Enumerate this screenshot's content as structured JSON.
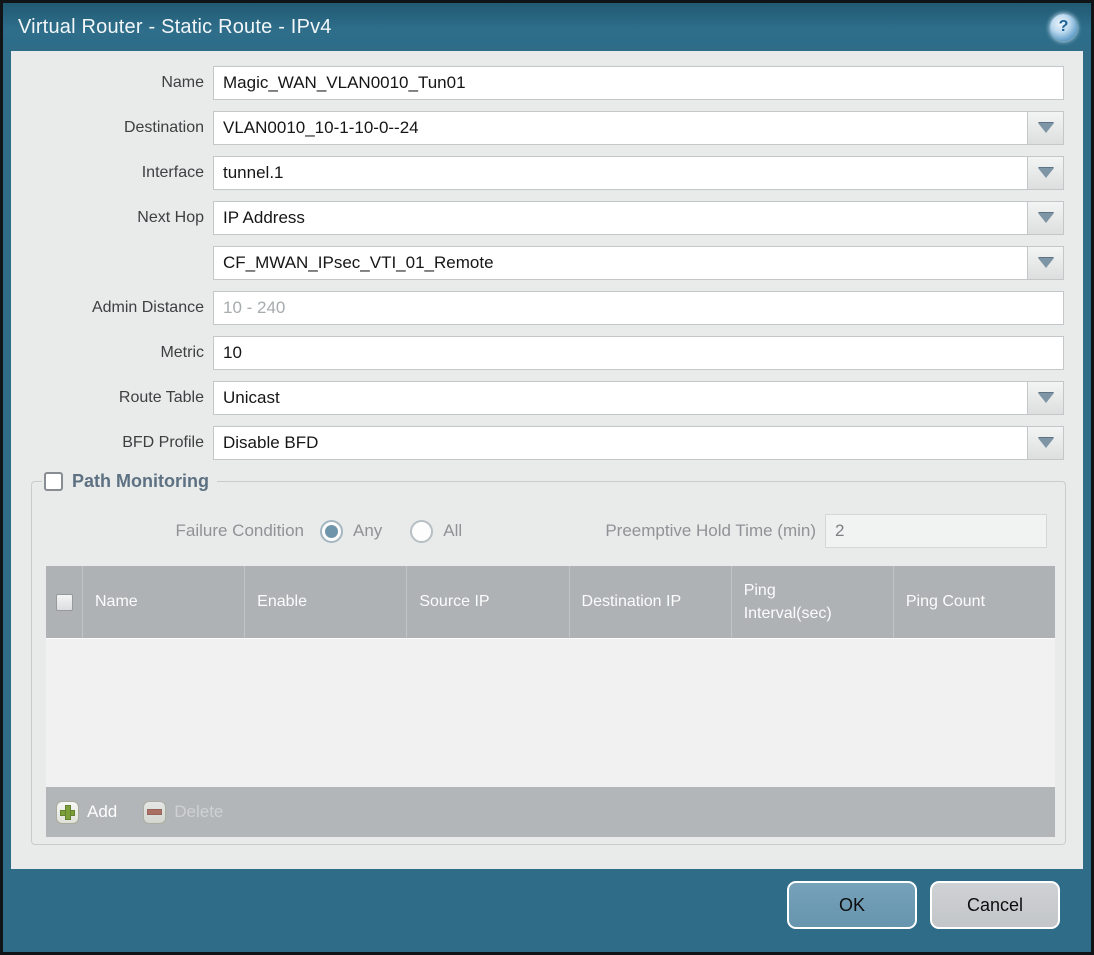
{
  "titlebar": {
    "title": "Virtual Router - Static Route - IPv4",
    "help_glyph": "?"
  },
  "form": {
    "name": {
      "label": "Name",
      "value": "Magic_WAN_VLAN0010_Tun01"
    },
    "destination": {
      "label": "Destination",
      "value": "VLAN0010_10-1-10-0--24"
    },
    "interface": {
      "label": "Interface",
      "value": "tunnel.1"
    },
    "next_hop": {
      "label": "Next Hop",
      "value": "IP Address"
    },
    "next_hop_address": {
      "value": "CF_MWAN_IPsec_VTI_01_Remote"
    },
    "admin_distance": {
      "label": "Admin Distance",
      "placeholder": "10 - 240"
    },
    "metric": {
      "label": "Metric",
      "value": "10"
    },
    "route_table": {
      "label": "Route Table",
      "value": "Unicast"
    },
    "bfd_profile": {
      "label": "BFD Profile",
      "value": "Disable BFD"
    }
  },
  "path_monitoring": {
    "title": "Path Monitoring",
    "enabled": false,
    "failure_condition": {
      "label": "Failure Condition",
      "options": [
        {
          "label": "Any",
          "selected": true
        },
        {
          "label": "All",
          "selected": false
        }
      ]
    },
    "preemptive_hold_time": {
      "label": "Preemptive Hold Time (min)",
      "value": "2"
    },
    "table": {
      "columns": [
        "Name",
        "Enable",
        "Source IP",
        "Destination IP",
        "Ping Interval(sec)",
        "Ping Count"
      ],
      "rows": []
    },
    "add_label": "Add",
    "delete_label": "Delete"
  },
  "footer": {
    "ok_label": "OK",
    "cancel_label": "Cancel"
  },
  "colors": {
    "titlebar_teal": "#2e6c88",
    "body_gray": "#e9eaea",
    "table_header_gray": "#aeb2b4",
    "ok_button": "#6f9cb4",
    "add_green": "#7c9f3b",
    "delete_red": "#a85948"
  }
}
